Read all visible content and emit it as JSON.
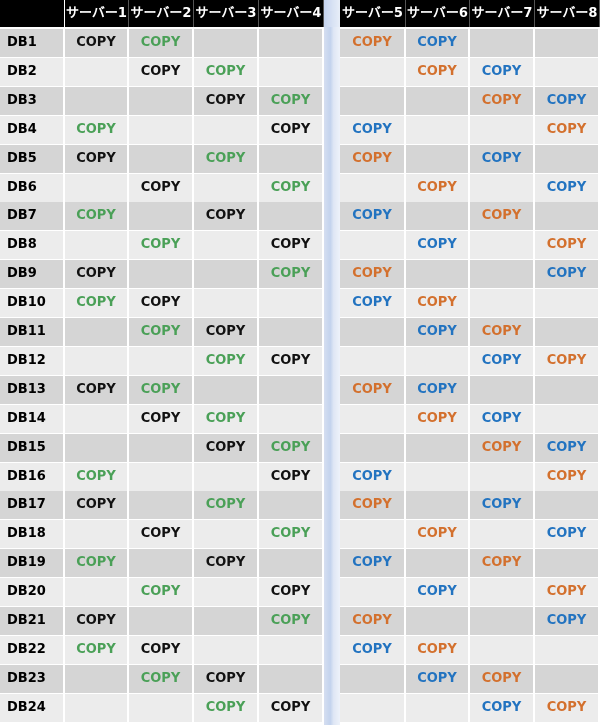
{
  "colors": {
    "black": "#111111",
    "green": "#4aa057",
    "orange": "#d3702d",
    "blue": "#2273c0",
    "header_bg": "#000000",
    "row_odd": "#d5d5d5",
    "row_even": "#ececec"
  },
  "headers": [
    "",
    "サーバー1",
    "サーバー2",
    "サーバー3",
    "サーバー4",
    "サーバー5",
    "サーバー6",
    "サーバー7",
    "サーバー8"
  ],
  "cell_text": "COPY",
  "rows": [
    {
      "label": "DB1",
      "cells": [
        "black",
        "green",
        "",
        "",
        "orange",
        "blue",
        "",
        ""
      ]
    },
    {
      "label": "DB2",
      "cells": [
        "",
        "black",
        "green",
        "",
        "",
        "orange",
        "blue",
        ""
      ]
    },
    {
      "label": "DB3",
      "cells": [
        "",
        "",
        "black",
        "green",
        "",
        "",
        "orange",
        "blue"
      ]
    },
    {
      "label": "DB4",
      "cells": [
        "green",
        "",
        "",
        "black",
        "blue",
        "",
        "",
        "orange"
      ]
    },
    {
      "label": "DB5",
      "cells": [
        "black",
        "",
        "green",
        "",
        "orange",
        "",
        "blue",
        ""
      ]
    },
    {
      "label": "DB6",
      "cells": [
        "",
        "black",
        "",
        "green",
        "",
        "orange",
        "",
        "blue"
      ]
    },
    {
      "label": "DB7",
      "cells": [
        "green",
        "",
        "black",
        "",
        "blue",
        "",
        "orange",
        ""
      ]
    },
    {
      "label": "DB8",
      "cells": [
        "",
        "green",
        "",
        "black",
        "",
        "blue",
        "",
        "orange"
      ]
    },
    {
      "label": "DB9",
      "cells": [
        "black",
        "",
        "",
        "green",
        "orange",
        "",
        "",
        "blue"
      ]
    },
    {
      "label": "DB10",
      "cells": [
        "green",
        "black",
        "",
        "",
        "blue",
        "orange",
        "",
        ""
      ]
    },
    {
      "label": "DB11",
      "cells": [
        "",
        "green",
        "black",
        "",
        "",
        "blue",
        "orange",
        ""
      ]
    },
    {
      "label": "DB12",
      "cells": [
        "",
        "",
        "green",
        "black",
        "",
        "",
        "blue",
        "orange"
      ]
    },
    {
      "label": "DB13",
      "cells": [
        "black",
        "green",
        "",
        "",
        "orange",
        "blue",
        "",
        ""
      ]
    },
    {
      "label": "DB14",
      "cells": [
        "",
        "black",
        "green",
        "",
        "",
        "orange",
        "blue",
        ""
      ]
    },
    {
      "label": "DB15",
      "cells": [
        "",
        "",
        "black",
        "green",
        "",
        "",
        "orange",
        "blue"
      ]
    },
    {
      "label": "DB16",
      "cells": [
        "green",
        "",
        "",
        "black",
        "blue",
        "",
        "",
        "orange"
      ]
    },
    {
      "label": "DB17",
      "cells": [
        "black",
        "",
        "green",
        "",
        "orange",
        "",
        "blue",
        ""
      ]
    },
    {
      "label": "DB18",
      "cells": [
        "",
        "black",
        "",
        "green",
        "",
        "orange",
        "",
        "blue"
      ]
    },
    {
      "label": "DB19",
      "cells": [
        "green",
        "",
        "black",
        "",
        "blue",
        "",
        "orange",
        ""
      ]
    },
    {
      "label": "DB20",
      "cells": [
        "",
        "green",
        "",
        "black",
        "",
        "blue",
        "",
        "orange"
      ]
    },
    {
      "label": "DB21",
      "cells": [
        "black",
        "",
        "",
        "green",
        "orange",
        "",
        "",
        "blue"
      ]
    },
    {
      "label": "DB22",
      "cells": [
        "green",
        "black",
        "",
        "",
        "blue",
        "orange",
        "",
        ""
      ]
    },
    {
      "label": "DB23",
      "cells": [
        "",
        "green",
        "black",
        "",
        "",
        "blue",
        "orange",
        ""
      ]
    },
    {
      "label": "DB24",
      "cells": [
        "",
        "",
        "green",
        "black",
        "",
        "",
        "blue",
        "orange"
      ]
    }
  ]
}
